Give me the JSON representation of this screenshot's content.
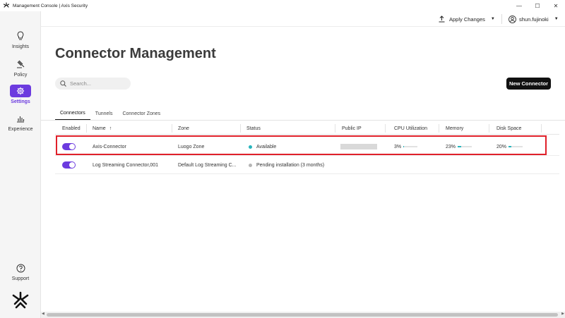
{
  "window": {
    "title": "Management Console | Axis Security",
    "minimize": "—",
    "maximize": "☐",
    "close": "✕"
  },
  "sidebar": {
    "items": [
      {
        "label": "Insights",
        "icon": "lightbulb-icon"
      },
      {
        "label": "Policy",
        "icon": "gavel-icon"
      },
      {
        "label": "Settings",
        "icon": "gear-icon",
        "active": true
      },
      {
        "label": "Experience",
        "icon": "bar-chart-icon"
      }
    ],
    "support": {
      "label": "Support",
      "icon": "question-circle-icon"
    }
  },
  "topbar": {
    "apply_changes": "Apply Changes",
    "username": "shun.fujinoki"
  },
  "page": {
    "title": "Connector Management",
    "search_placeholder": "Search...",
    "new_button": "New Connector"
  },
  "tabs": [
    "Connectors",
    "Tunnels",
    "Connector Zones"
  ],
  "table": {
    "columns": [
      "Enabled",
      "Name",
      "Zone",
      "Status",
      "Public IP",
      "CPU Utilization",
      "Memory",
      "Disk Space"
    ],
    "sort_indicator": "↑",
    "rows": [
      {
        "enabled": true,
        "name": "Axis-Connector",
        "zone": "Luogo Zone",
        "status": "Available",
        "status_color": "#27b5bd",
        "cpu": "3%",
        "cpu_value": 3,
        "memory": "23%",
        "memory_value": 23,
        "disk": "20%",
        "disk_value": 20
      },
      {
        "enabled": true,
        "name": "Log Streaming Connector,001",
        "zone": "Default Log Streaming C...",
        "status": "Pending installation (3 months)",
        "status_color": "#b5b5b5"
      }
    ]
  },
  "colors": {
    "accent": "#6c3bdf",
    "highlight": "#e0202a",
    "available": "#27b5bd"
  }
}
